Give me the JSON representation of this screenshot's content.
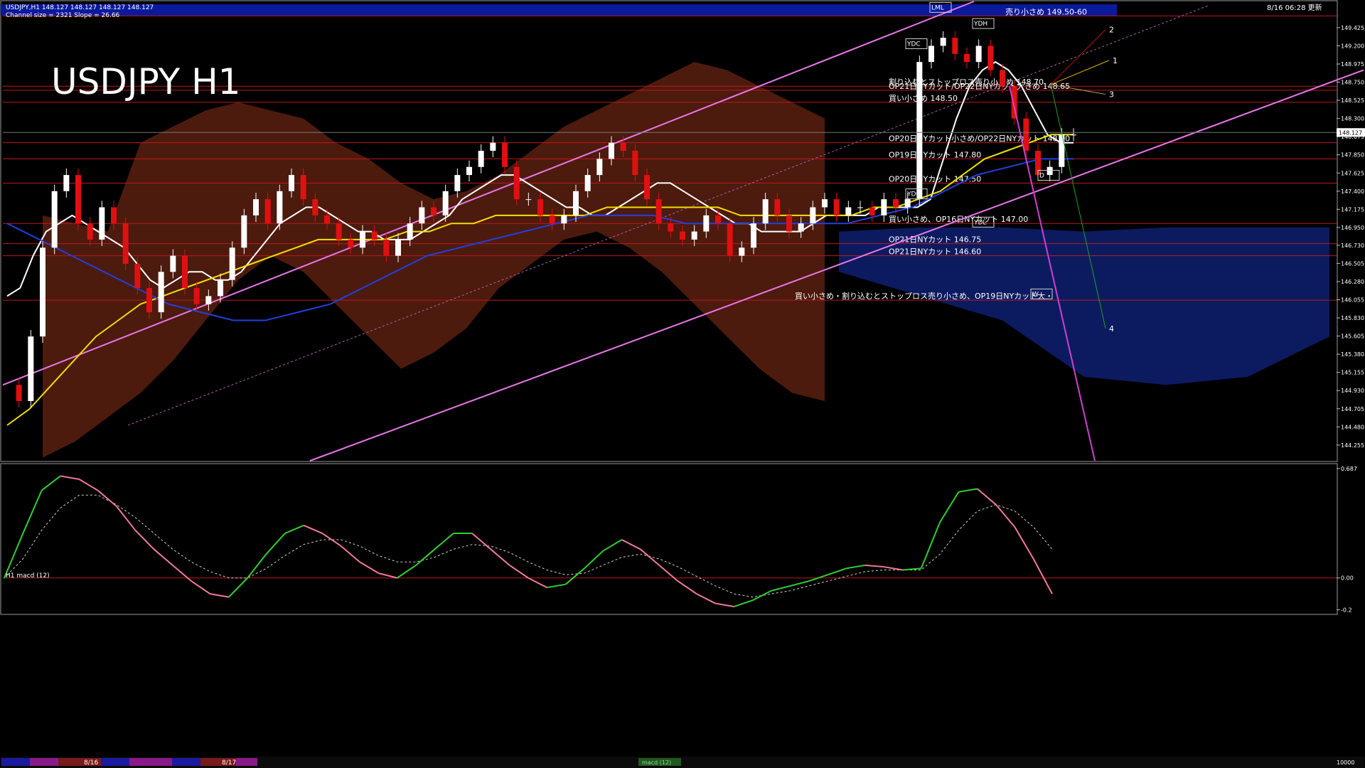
{
  "chart_data": [
    {
      "type": "line",
      "header_line1": "USDJPY,H1  148.127 148.127 148.127 148.127",
      "header_line2": "Channel size = 2321 Slope = 26.66",
      "big_title": "USDJPY H1",
      "timestamp": "8/16 06:28 更新",
      "current_price_label": "148.127",
      "current_price": 148.127,
      "ylim": [
        144.06,
        149.75
      ],
      "y_ticks": [
        "149.425",
        "149.200",
        "148.975",
        "148.750",
        "148.525",
        "148.300",
        "148.075",
        "147.850",
        "147.625",
        "147.400",
        "147.175",
        "146.950",
        "146.730",
        "146.505",
        "146.280",
        "146.055",
        "145.830",
        "145.605",
        "145.380",
        "145.155",
        "144.930",
        "144.705",
        "144.480",
        "144.255"
      ],
      "levels": [
        {
          "price": 149.57,
          "label": "売り小さめ 149.50-60"
        },
        {
          "price": 148.7,
          "label": "割り込むとストップロス売り小さめ 148.70"
        },
        {
          "price": 148.65,
          "label": "OP21日NYカット/OP22日NYカット大きめ 148.65"
        },
        {
          "price": 148.5,
          "label": "買い小さめ 148.50"
        },
        {
          "price": 148.0,
          "label": "OP20日NYカット小さめ/OP22日NYカット 148.00"
        },
        {
          "price": 147.8,
          "label": "OP19日NYカット 147.80"
        },
        {
          "price": 147.5,
          "label": "OP20日NYカット 147.50"
        },
        {
          "price": 147.0,
          "label": "買い小さめ、OP16日NYカット 147.00"
        },
        {
          "price": 146.75,
          "label": "OP21日NYカット 146.75"
        },
        {
          "price": 146.6,
          "label": "OP21日NYカット 146.60"
        },
        {
          "price": 146.05,
          "label": "買い小さめ・割り込むとストップロス売り小さめ、OP19日NYカット大・"
        }
      ],
      "box_labels": [
        "LML",
        "YDH",
        "YDC",
        "YDO",
        "YDL",
        "W",
        "D"
      ],
      "scenario_labels": [
        "1",
        "2",
        "3",
        "4"
      ],
      "series": [
        {
          "name": "price",
          "values": [
            145.0,
            144.8,
            145.6,
            146.7,
            147.4,
            147.6,
            147.0,
            146.8,
            147.2,
            147.0,
            146.5,
            146.2,
            145.9,
            146.4,
            146.6,
            146.2,
            146.0,
            146.1,
            146.3,
            146.7,
            147.1,
            147.3,
            147.0,
            147.4,
            147.6,
            147.3,
            147.1,
            147.0,
            146.8,
            146.7,
            146.9,
            146.8,
            146.6,
            146.8,
            147.0,
            147.2,
            147.1,
            147.4,
            147.6,
            147.7,
            147.9,
            148.0,
            147.7,
            147.3,
            147.3,
            147.1,
            147.0,
            147.1,
            147.4,
            147.6,
            147.8,
            148.0,
            147.9,
            147.6,
            147.3,
            147.0,
            146.9,
            146.8,
            146.9,
            147.1,
            147.0,
            146.6,
            146.7,
            147.0,
            147.3,
            147.1,
            146.9,
            147.0,
            147.2,
            147.3,
            147.1,
            147.2,
            147.2,
            147.1,
            147.3,
            147.2,
            147.3,
            149.0,
            149.2,
            149.3,
            149.1,
            149.0,
            149.2,
            148.9,
            148.7,
            148.3,
            147.9,
            147.6,
            147.7,
            148.1,
            148.1
          ]
        },
        {
          "name": "sma_short",
          "values": [
            146.1,
            146.2,
            146.6,
            146.9,
            147.0,
            147.1,
            147.0,
            146.9,
            146.8,
            146.7,
            146.5,
            146.3,
            146.2,
            146.3,
            146.4,
            146.4,
            146.3,
            146.3,
            146.4,
            146.6,
            146.8,
            147.0,
            147.1,
            147.2,
            147.2,
            147.1,
            147.0,
            146.9,
            146.9,
            146.8,
            146.8,
            146.8,
            146.9,
            147.0,
            147.1,
            147.3,
            147.4,
            147.5,
            147.6,
            147.6,
            147.5,
            147.4,
            147.3,
            147.2,
            147.2,
            147.1,
            147.1,
            147.2,
            147.3,
            147.4,
            147.5,
            147.5,
            147.4,
            147.3,
            147.2,
            147.1,
            147.0,
            147.0,
            146.9,
            146.9,
            146.9,
            146.9,
            147.0,
            147.1,
            147.1,
            147.1,
            147.1,
            147.2,
            147.2,
            147.2,
            147.2,
            147.3,
            147.8,
            148.3,
            148.7,
            148.9,
            149.0,
            148.9,
            148.7,
            148.4,
            148.1,
            148.0,
            148.0
          ]
        },
        {
          "name": "sma_mid",
          "values": [
            144.5,
            144.7,
            145.0,
            145.3,
            145.6,
            145.8,
            146.0,
            146.1,
            146.2,
            146.3,
            146.4,
            146.5,
            146.6,
            146.7,
            146.8,
            146.8,
            146.8,
            146.8,
            146.9,
            146.9,
            147.0,
            147.0,
            147.1,
            147.1,
            147.1,
            147.1,
            147.1,
            147.2,
            147.2,
            147.2,
            147.2,
            147.2,
            147.2,
            147.1,
            147.1,
            147.1,
            147.1,
            147.1,
            147.1,
            147.2,
            147.2,
            147.3,
            147.4,
            147.6,
            147.8,
            147.9,
            148.0,
            148.1,
            148.1
          ]
        },
        {
          "name": "sma_long",
          "values": [
            147.0,
            146.8,
            146.6,
            146.4,
            146.2,
            146.0,
            145.9,
            145.8,
            145.8,
            145.9,
            146.0,
            146.2,
            146.4,
            146.6,
            146.7,
            146.8,
            146.9,
            147.0,
            147.1,
            147.1,
            147.1,
            147.0,
            147.0,
            147.0,
            147.0,
            147.0,
            147.0,
            147.1,
            147.2,
            147.4,
            147.6,
            147.7,
            147.8,
            147.8
          ]
        }
      ],
      "indicator": {
        "title": "H1 macd (12)",
        "ylim": [
          -0.22,
          0.7
        ],
        "y_ticks": [
          "0.687",
          "0.00",
          "-0.2"
        ],
        "macd": [
          0.0,
          0.28,
          0.55,
          0.64,
          0.62,
          0.55,
          0.45,
          0.3,
          0.18,
          0.08,
          -0.02,
          -0.1,
          -0.12,
          0.0,
          0.15,
          0.28,
          0.33,
          0.28,
          0.2,
          0.1,
          0.03,
          0.0,
          0.08,
          0.18,
          0.28,
          0.28,
          0.18,
          0.08,
          0.0,
          -0.06,
          -0.04,
          0.06,
          0.17,
          0.24,
          0.18,
          0.08,
          -0.02,
          -0.1,
          -0.16,
          -0.18,
          -0.14,
          -0.08,
          -0.05,
          -0.02,
          0.02,
          0.06,
          0.08,
          0.07,
          0.05,
          0.06,
          0.35,
          0.54,
          0.56,
          0.46,
          0.32,
          0.12,
          -0.1
        ],
        "signal": [
          0.0,
          0.12,
          0.3,
          0.44,
          0.52,
          0.52,
          0.46,
          0.38,
          0.28,
          0.18,
          0.1,
          0.04,
          0.0,
          0.0,
          0.06,
          0.14,
          0.21,
          0.24,
          0.24,
          0.2,
          0.14,
          0.1,
          0.1,
          0.13,
          0.18,
          0.21,
          0.2,
          0.16,
          0.1,
          0.05,
          0.02,
          0.03,
          0.08,
          0.13,
          0.15,
          0.12,
          0.07,
          0.01,
          -0.05,
          -0.1,
          -0.12,
          -0.1,
          -0.08,
          -0.05,
          -0.02,
          0.01,
          0.04,
          0.05,
          0.05,
          0.05,
          0.15,
          0.3,
          0.42,
          0.46,
          0.42,
          0.32,
          0.18
        ]
      }
    }
  ],
  "footer": {
    "date1": "8/16",
    "date2": "8/17",
    "macd_tab": "macd (12)",
    "right_label": "10000"
  }
}
